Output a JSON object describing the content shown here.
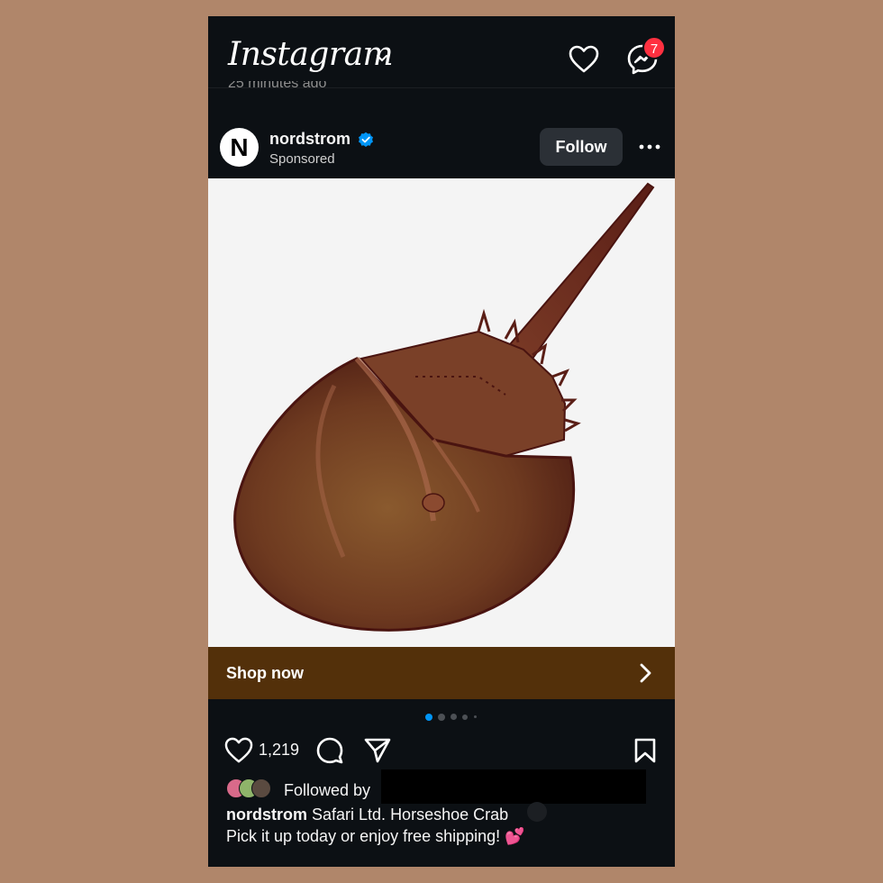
{
  "app": {
    "logo_text": "Instagram",
    "notification_count": "7",
    "timestamp_partial": "25 minutes ago"
  },
  "post": {
    "username": "nordstrom",
    "avatar_letter": "N",
    "label": "Sponsored",
    "follow_label": "Follow",
    "image_subject": "Horseshoe crab toy figurine on white background",
    "cta_label": "Shop now",
    "carousel_dots": 5,
    "carousel_active_index": 0,
    "likes": "1,219",
    "followed_by_label": "Followed by",
    "caption_username": "nordstrom",
    "caption_line1": "Safari Ltd. Horseshoe Crab",
    "caption_line2": "Pick it up today or enjoy free shipping! 💕"
  },
  "colors": {
    "background": "#b0866a",
    "app_bg": "#0c1014",
    "badge": "#ff3040",
    "verified": "#0095f6",
    "cta_bar": "#53300a",
    "carousel_active": "#0095f6"
  },
  "icons": [
    "chevron-down-icon",
    "heart-icon",
    "messenger-icon",
    "verified-icon",
    "more-icon",
    "chevron-right-icon",
    "comment-icon",
    "share-icon",
    "bookmark-icon",
    "two-hearts-icon"
  ]
}
